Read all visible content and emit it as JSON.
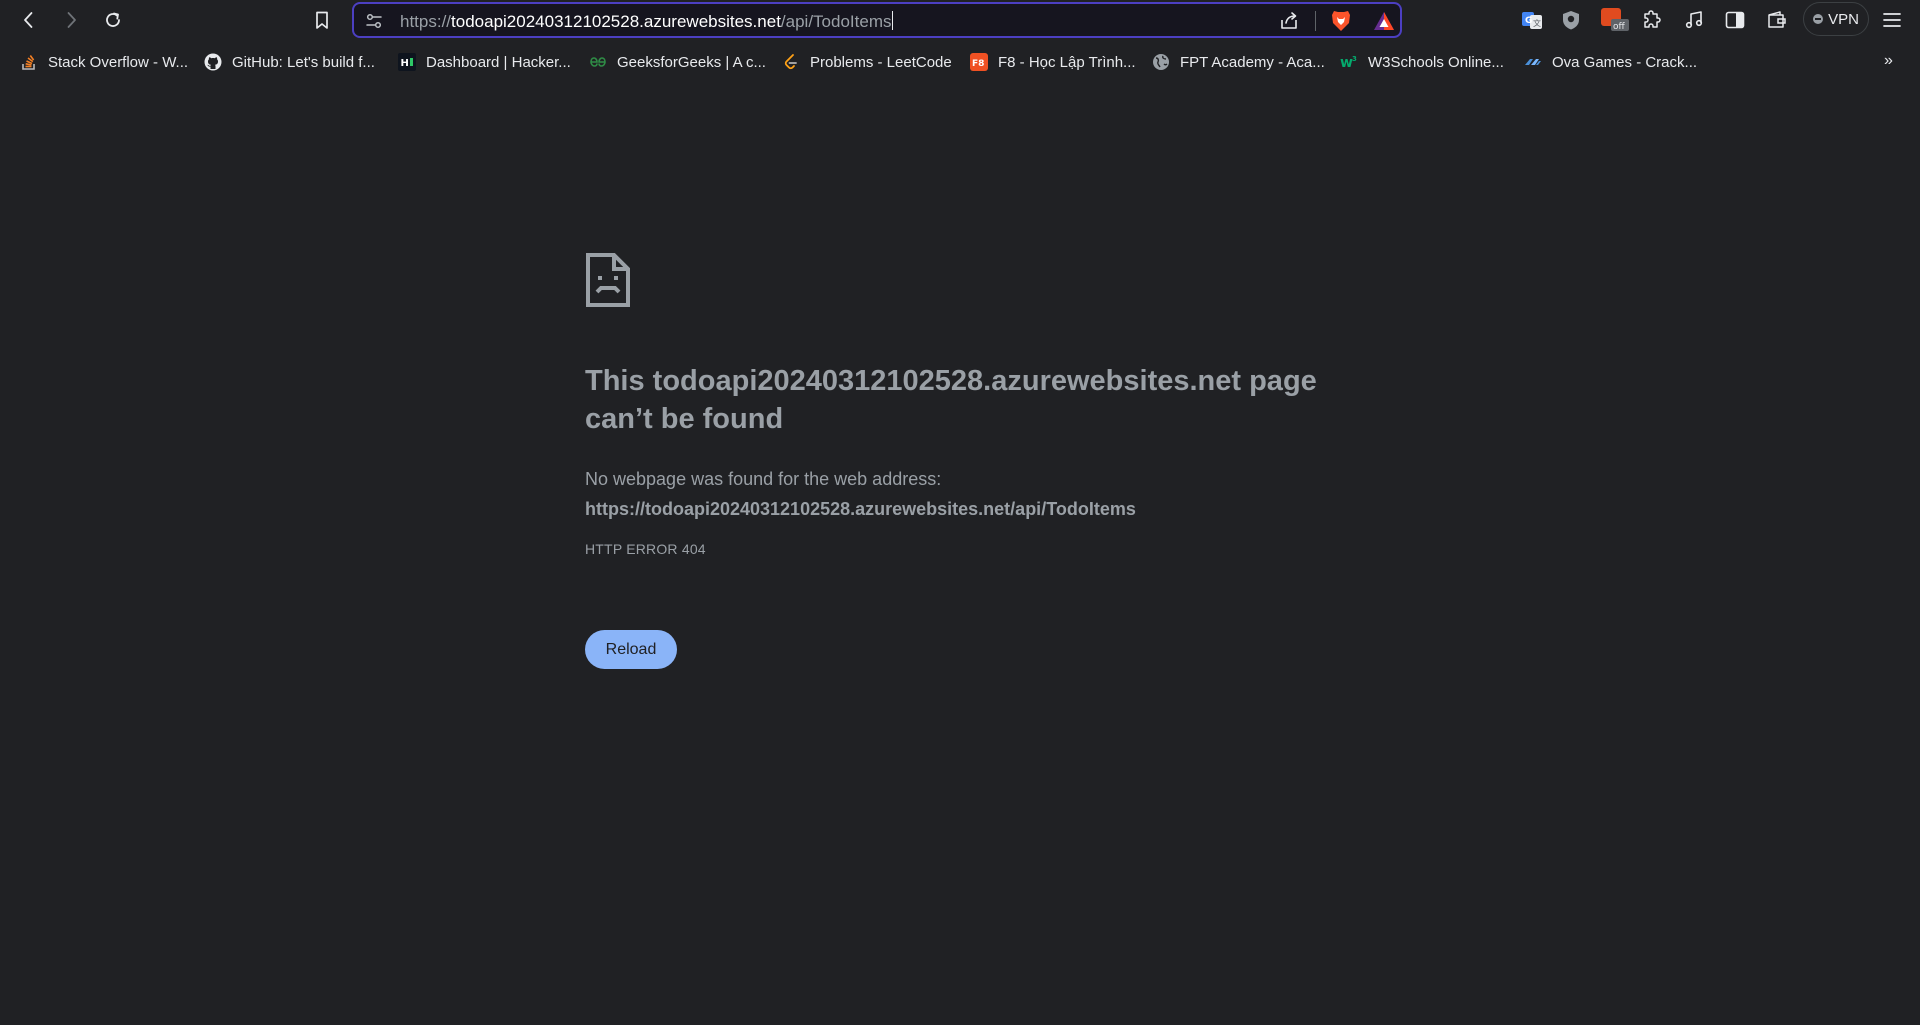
{
  "toolbar": {
    "back": "back-icon",
    "forward": "forward-icon",
    "reload": "reload-icon",
    "bookmark": "bookmark-icon",
    "url_scheme": "https://",
    "url_host": "todoapi20240312102528.azurewebsites.net",
    "url_path": "/api/TodoItems",
    "vpn_label": "VPN",
    "extension_badge": "off",
    "accent_color": "#4c3fc2"
  },
  "bookmarks": [
    {
      "label": "Stack Overflow - W...",
      "icon": "stackoverflow-icon"
    },
    {
      "label": "GitHub: Let's build f...",
      "icon": "github-icon"
    },
    {
      "label": "Dashboard | Hacker...",
      "icon": "hackerrank-icon"
    },
    {
      "label": "GeeksforGeeks | A c...",
      "icon": "geeksforgeeks-icon"
    },
    {
      "label": "Problems - LeetCode",
      "icon": "leetcode-icon"
    },
    {
      "label": "F8 - Học Lập Trình...",
      "icon": "f8-icon"
    },
    {
      "label": "FPT Academy - Aca...",
      "icon": "globe-icon"
    },
    {
      "label": "W3Schools Online...",
      "icon": "w3schools-icon"
    },
    {
      "label": "Ova Games - Crack...",
      "icon": "ovagames-icon"
    }
  ],
  "error": {
    "title": "This todoapi20240312102528.azurewebsites.net page can’t be found",
    "message": "No webpage was found for the web address:",
    "url": "https://todoapi20240312102528.azurewebsites.net/api/TodoItems",
    "code": "HTTP ERROR 404",
    "reload_label": "Reload",
    "button_color": "#8ab4f8"
  }
}
